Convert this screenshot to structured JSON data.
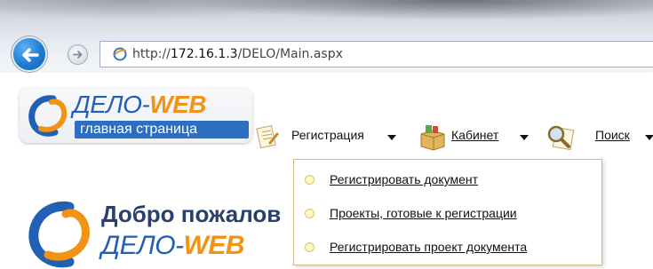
{
  "browser": {
    "url_prefix": "http://",
    "url_host": "172.16.1.3",
    "url_path": "/DELO/Main.aspx"
  },
  "logo": {
    "title_main": "ДЕЛО-",
    "title_web": "WEB",
    "subtitle": "главная страница"
  },
  "menu": [
    {
      "label": "Регистрация",
      "icon": "registration-icon"
    },
    {
      "label": "Кабинет",
      "icon": "cabinet-icon"
    },
    {
      "label": "Поиск",
      "icon": "search-icon"
    }
  ],
  "dropdown": {
    "items": [
      {
        "label": "Регистрировать документ"
      },
      {
        "label": "Проекты, готовые к регистрации"
      },
      {
        "label": "Регистрировать проект документа"
      }
    ]
  },
  "welcome": {
    "line1": "Добро пожалов",
    "line2_main": "ДЕЛО-",
    "line2_web": "WEB"
  },
  "colors": {
    "brand_blue": "#2260b5",
    "brand_orange": "#f39314",
    "dropdown_border": "#d4b886"
  }
}
